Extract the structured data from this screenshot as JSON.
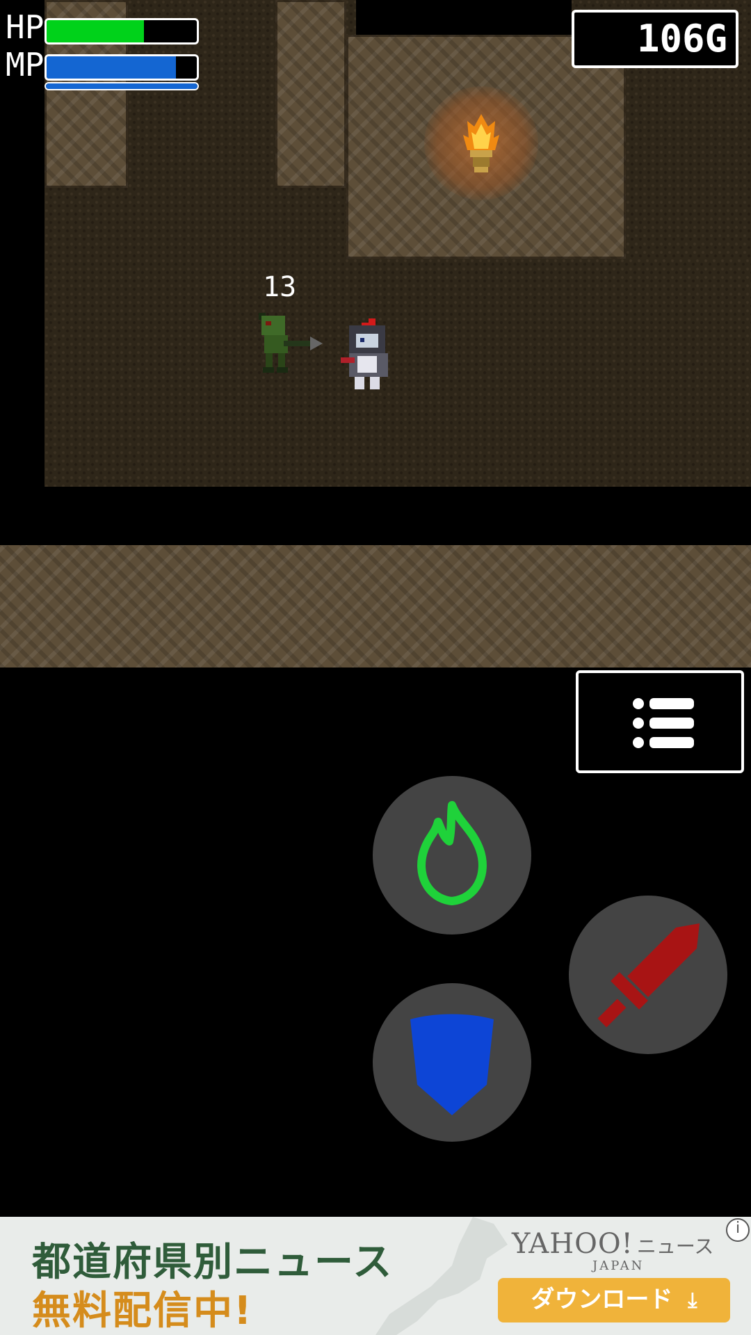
{
  "hud": {
    "hp_label": "HP",
    "mp_label": "MP",
    "hp_level": 0.65,
    "mp_level": 0.86,
    "mp_secondary_level": 1.0,
    "hp_color": "#00d21a",
    "mp_color": "#1466d2",
    "gold": "106G"
  },
  "battle": {
    "damage_number": "13"
  },
  "controls": {
    "menu_icon": "list-icon",
    "magic_icon": "flame-icon",
    "magic_color": "#1fd23a",
    "guard_icon": "shield-icon",
    "guard_color": "#0d45d6",
    "attack_icon": "sword-icon",
    "attack_color": "#a81414"
  },
  "ad": {
    "line1": "都道府県別ニュース",
    "line2": "無料配信中!",
    "brand": "YAHOO!",
    "brand_sub": "JAPAN",
    "brand_news": "ニュース",
    "download_label": "ダウンロード",
    "info_icon": "info-icon"
  }
}
